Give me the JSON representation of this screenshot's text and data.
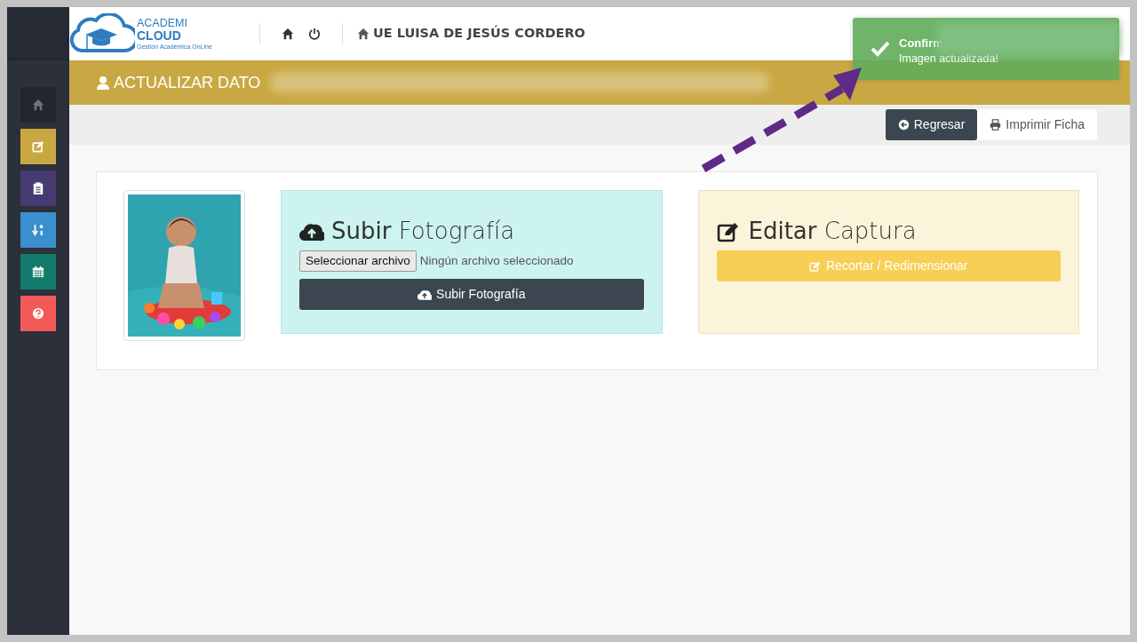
{
  "logo": {
    "line_1": "ACADEMI",
    "line_2": "CLOUD",
    "tagline": "Gestión Académica OnLine"
  },
  "header": {
    "institution": "UE LUISA DE JESÚS CORDERO"
  },
  "sidebar": {
    "items": [
      {
        "kind": "home",
        "color": "#22262e"
      },
      {
        "kind": "edit",
        "color": "#c9a843"
      },
      {
        "kind": "clipboard",
        "color": "#463a72"
      },
      {
        "kind": "sort",
        "color": "#3a8fce"
      },
      {
        "kind": "calendar",
        "color": "#127c6c"
      },
      {
        "kind": "help",
        "color": "#f25a57"
      }
    ]
  },
  "page_title": "ACTUALIZAR DATO",
  "toolbar": {
    "buttons": [
      {
        "label": "Regresar",
        "kind": "dark"
      },
      {
        "label": "Imprimir Ficha",
        "kind": "light"
      }
    ]
  },
  "upload": {
    "title": "**Subir** Fotografía",
    "file_button": "Seleccionar archivo",
    "file_status": "Ningún archivo seleccionado",
    "submit": "Subir Fotografía"
  },
  "edit": {
    "title": "**Editar** Captura",
    "button": "Recortar / Redimensionar"
  },
  "toast": {
    "title": "Confirm",
    "message": "Imagen actualizada!"
  }
}
